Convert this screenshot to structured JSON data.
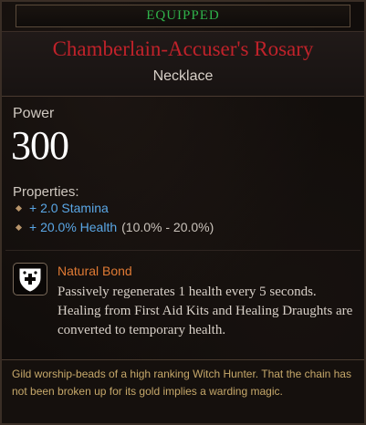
{
  "tooltip": {
    "status_label": "EQUIPPED",
    "item_name": "Chamberlain-Accuser's Rosary",
    "item_type": "Necklace",
    "power_label": "Power",
    "power_value": "300",
    "properties_label": "Properties:",
    "properties": [
      {
        "text": "+ 2.0 Stamina",
        "range": ""
      },
      {
        "text": "+ 20.0% Health",
        "range": "(10.0% - 20.0%)"
      }
    ],
    "trait": {
      "icon": "shield-plus-icon",
      "name": "Natural Bond",
      "description": "Passively regenerates 1 health every 5 seconds. Healing from First Aid Kits and Healing Draughts are converted to temporary health."
    },
    "flavor_text": "Gild worship-beads of a high ranking Witch Hunter. That the chain has not been broken up for its gold implies a warding magic."
  },
  "colors": {
    "equipped_green": "#2fb24a",
    "item_name_red": "#c0222a",
    "property_blue": "#5aa7e6",
    "trait_orange": "#e07a34",
    "flavor_gold": "#c6a86a"
  }
}
